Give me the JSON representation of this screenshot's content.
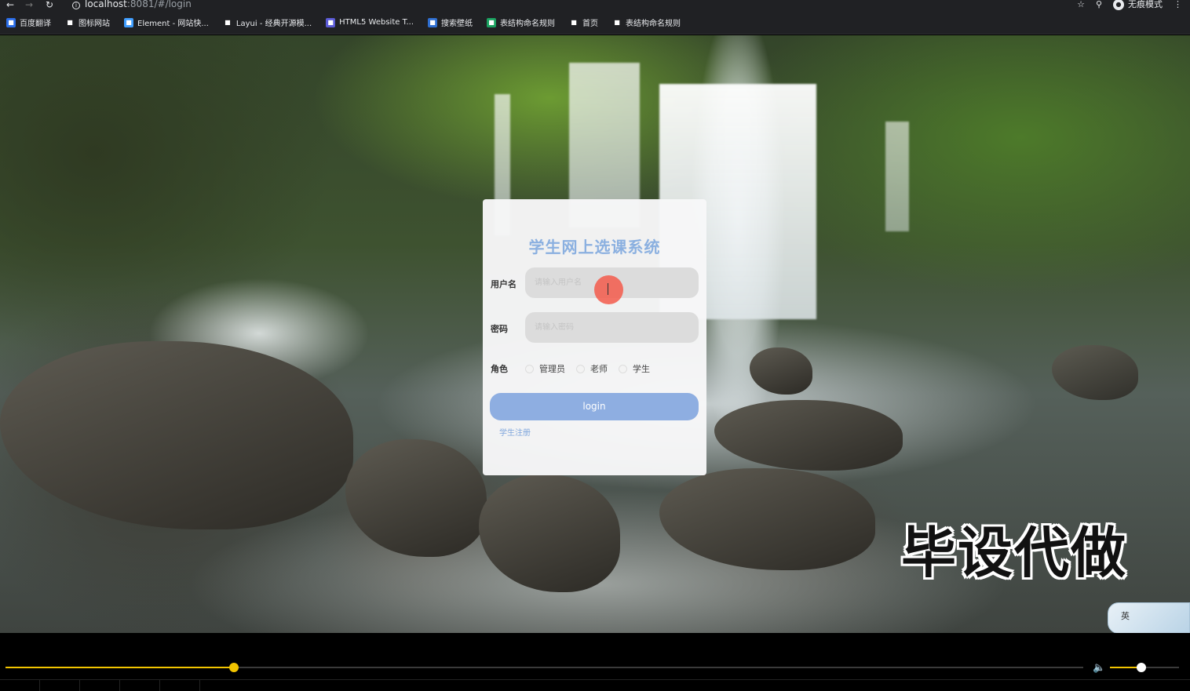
{
  "browser": {
    "url_host": "localhost",
    "url_path": ":8081/#/login",
    "incognito_label": "无痕模式",
    "bookmarks": [
      {
        "label": "百度翻译",
        "icon": "translate-icon",
        "color": "#2b6de8"
      },
      {
        "label": "图标网站",
        "icon": "flag-icon",
        "color": "#202124"
      },
      {
        "label": "Element - 网站快...",
        "icon": "element-icon",
        "color": "#409eff"
      },
      {
        "label": "Layui - 经典开源模...",
        "icon": "layui-icon",
        "color": "#202124"
      },
      {
        "label": "HTML5 Website T...",
        "icon": "html5-icon",
        "color": "#5b5bd6"
      },
      {
        "label": "搜索壁纸",
        "icon": "wallpaper-icon",
        "color": "#2f6fd1"
      },
      {
        "label": "表结构命名规则",
        "icon": "table-icon",
        "color": "#1aa260"
      },
      {
        "label": "首页",
        "icon": "globe-icon",
        "color": "#202124"
      },
      {
        "label": "表结构命名规则",
        "icon": "globe-icon",
        "color": "#202124"
      }
    ]
  },
  "login": {
    "title": "学生网上选课系统",
    "username_label": "用户名",
    "username_placeholder": "请输入用户名",
    "password_label": "密码",
    "password_placeholder": "请输入密码",
    "role_label": "角色",
    "roles": [
      "管理员",
      "老师",
      "学生"
    ],
    "login_button": "login",
    "register_link": "学生注册"
  },
  "overlay": {
    "watermark": "毕设代做",
    "ime_label": "英"
  },
  "player": {
    "progress_fraction": 0.212,
    "volume_fraction": 0.45
  }
}
